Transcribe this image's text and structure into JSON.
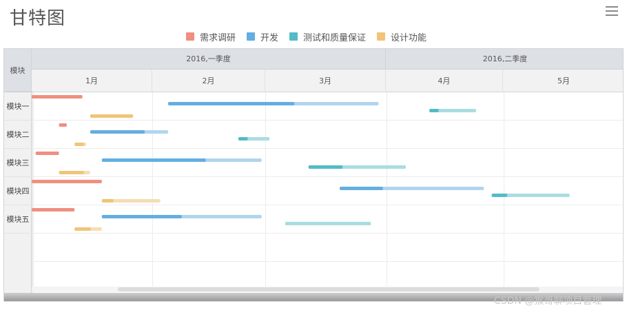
{
  "title": "甘特图",
  "legend": [
    {
      "label": "需求调研",
      "color": "#f08f80"
    },
    {
      "label": "开发",
      "color": "#64aee1"
    },
    {
      "label": "测试和质量保证",
      "color": "#52bcc6"
    },
    {
      "label": "设计功能",
      "color": "#f1c478"
    }
  ],
  "header": {
    "corner": "模块",
    "quarters": [
      "2016,一季度",
      "2016,二季度"
    ],
    "months": [
      "1月",
      "2月",
      "3月",
      "4月",
      "5月"
    ]
  },
  "rows": [
    "模块一",
    "模块二",
    "模块三",
    "模块四",
    "模块五"
  ],
  "watermark": "CSDN @猴哥聊项目管理",
  "chart_data": {
    "type": "gantt",
    "title": "甘特图",
    "x_unit": "date",
    "xlim": [
      "2016-01-01",
      "2016-05-31"
    ],
    "categories": [
      "模块一",
      "模块二",
      "模块三",
      "模块四",
      "模块五"
    ],
    "series": [
      {
        "name": "需求调研",
        "color": "#f08f80",
        "light": "#f6b8ae",
        "tasks": [
          {
            "row": "模块一",
            "start": "2016-01-01",
            "end": "2016-01-14",
            "progress": 1.0
          },
          {
            "row": "模块二",
            "start": "2016-01-08",
            "end": "2016-01-10",
            "progress": 1.0
          },
          {
            "row": "模块三",
            "start": "2016-01-02",
            "end": "2016-01-08",
            "progress": 1.0
          },
          {
            "row": "模块四",
            "start": "2016-01-01",
            "end": "2016-01-19",
            "progress": 1.0
          },
          {
            "row": "模块五",
            "start": "2016-01-01",
            "end": "2016-01-12",
            "progress": 1.0
          }
        ]
      },
      {
        "name": "开发",
        "color": "#64aee1",
        "light": "#b1d5ee",
        "tasks": [
          {
            "row": "模块一",
            "start": "2016-02-05",
            "end": "2016-03-30",
            "progress": 0.6
          },
          {
            "row": "模块二",
            "start": "2016-01-16",
            "end": "2016-02-05",
            "progress": 0.7
          },
          {
            "row": "模块三",
            "start": "2016-01-19",
            "end": "2016-02-29",
            "progress": 0.65
          },
          {
            "row": "模块四",
            "start": "2016-03-20",
            "end": "2016-04-26",
            "progress": 0.3
          },
          {
            "row": "模块五",
            "start": "2016-01-19",
            "end": "2016-02-29",
            "progress": 0.5
          }
        ]
      },
      {
        "name": "测试和质量保证",
        "color": "#52bcc6",
        "light": "#aadde1",
        "tasks": [
          {
            "row": "模块一",
            "start": "2016-04-12",
            "end": "2016-04-24",
            "progress": 0.2
          },
          {
            "row": "模块二",
            "start": "2016-02-23",
            "end": "2016-03-02",
            "progress": 0.3
          },
          {
            "row": "模块三",
            "start": "2016-03-12",
            "end": "2016-04-06",
            "progress": 0.35
          },
          {
            "row": "模块四",
            "start": "2016-04-28",
            "end": "2016-05-18",
            "progress": 0.2
          },
          {
            "row": "模块五",
            "start": "2016-03-06",
            "end": "2016-03-28",
            "progress": 0.0
          }
        ]
      },
      {
        "name": "设计功能",
        "color": "#f1c478",
        "light": "#f5deb4",
        "tasks": [
          {
            "row": "模块一",
            "start": "2016-01-16",
            "end": "2016-01-27",
            "progress": 1.0
          },
          {
            "row": "模块二",
            "start": "2016-01-12",
            "end": "2016-01-15",
            "progress": 0.8
          },
          {
            "row": "模块三",
            "start": "2016-01-08",
            "end": "2016-01-16",
            "progress": 0.8
          },
          {
            "row": "模块四",
            "start": "2016-01-19",
            "end": "2016-02-03",
            "progress": 0.2
          },
          {
            "row": "模块五",
            "start": "2016-01-12",
            "end": "2016-01-19",
            "progress": 0.6
          }
        ]
      }
    ]
  }
}
